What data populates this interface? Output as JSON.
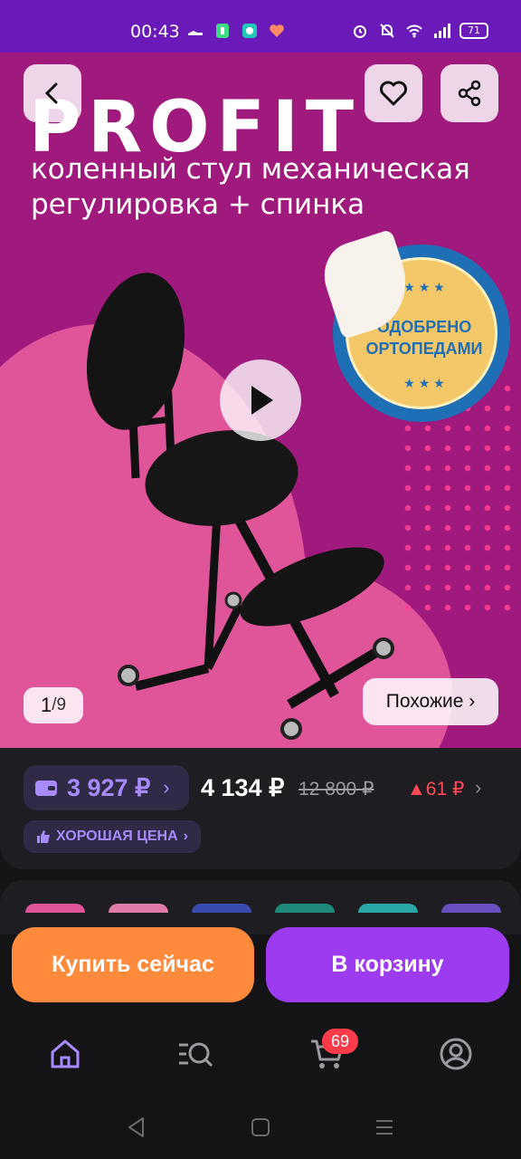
{
  "status_bar": {
    "time": "00:43",
    "battery": "71"
  },
  "hero": {
    "brand": "PROFIT",
    "subtitle": "коленный стул механическая регулировка + спинка",
    "seal_text": "ОДОБРЕНО ОРТОПЕДАМИ",
    "image_index": "1",
    "image_total": "9",
    "similar_label": "Похожие ›"
  },
  "price": {
    "wallet_price": "3 927 ₽",
    "current_price": "4 134 ₽",
    "old_price": "12 800 ₽",
    "delta": "▲61 ₽",
    "good_price_label": "ХОРОШАЯ ЦЕНА"
  },
  "actions": {
    "buy_now": "Купить сейчас",
    "to_cart": "В корзину"
  },
  "bottom_nav": {
    "cart_count": "69",
    "items": [
      "home-icon",
      "catalog-search-icon",
      "cart-icon",
      "profile-icon"
    ]
  },
  "colors": {
    "status_bar": "#6a1ab8",
    "hero_bg": "#a01a7e",
    "accent_purple": "#9d3bf0",
    "accent_orange": "#ff8a3c",
    "badge_red": "#ff3b4a"
  }
}
